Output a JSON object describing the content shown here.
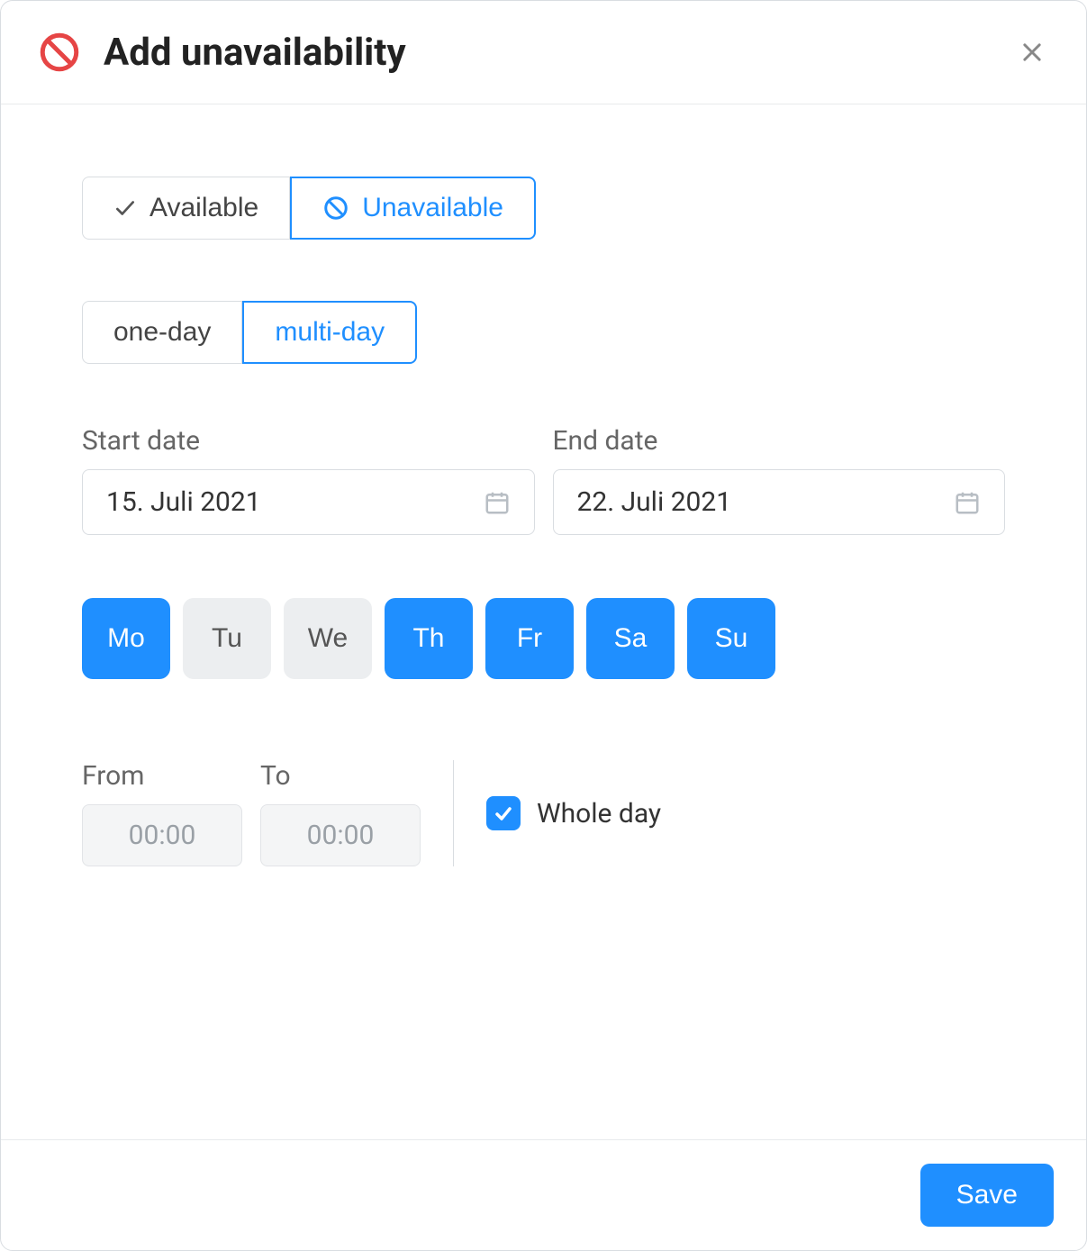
{
  "header": {
    "title": "Add unavailability"
  },
  "availability": {
    "available_label": "Available",
    "unavailable_label": "Unavailable",
    "selected": "unavailable"
  },
  "duration": {
    "one_day_label": "one-day",
    "multi_day_label": "multi-day",
    "selected": "multi-day"
  },
  "dates": {
    "start_label": "Start date",
    "start_value": "15. Juli 2021",
    "end_label": "End date",
    "end_value": "22. Juli 2021"
  },
  "weekdays": [
    {
      "abbr": "Mo",
      "on": true
    },
    {
      "abbr": "Tu",
      "on": false
    },
    {
      "abbr": "We",
      "on": false
    },
    {
      "abbr": "Th",
      "on": true
    },
    {
      "abbr": "Fr",
      "on": true
    },
    {
      "abbr": "Sa",
      "on": true
    },
    {
      "abbr": "Su",
      "on": true
    }
  ],
  "time": {
    "from_label": "From",
    "from_value": "00:00",
    "to_label": "To",
    "to_value": "00:00",
    "whole_day_label": "Whole day",
    "whole_day_checked": true
  },
  "footer": {
    "save_label": "Save"
  }
}
